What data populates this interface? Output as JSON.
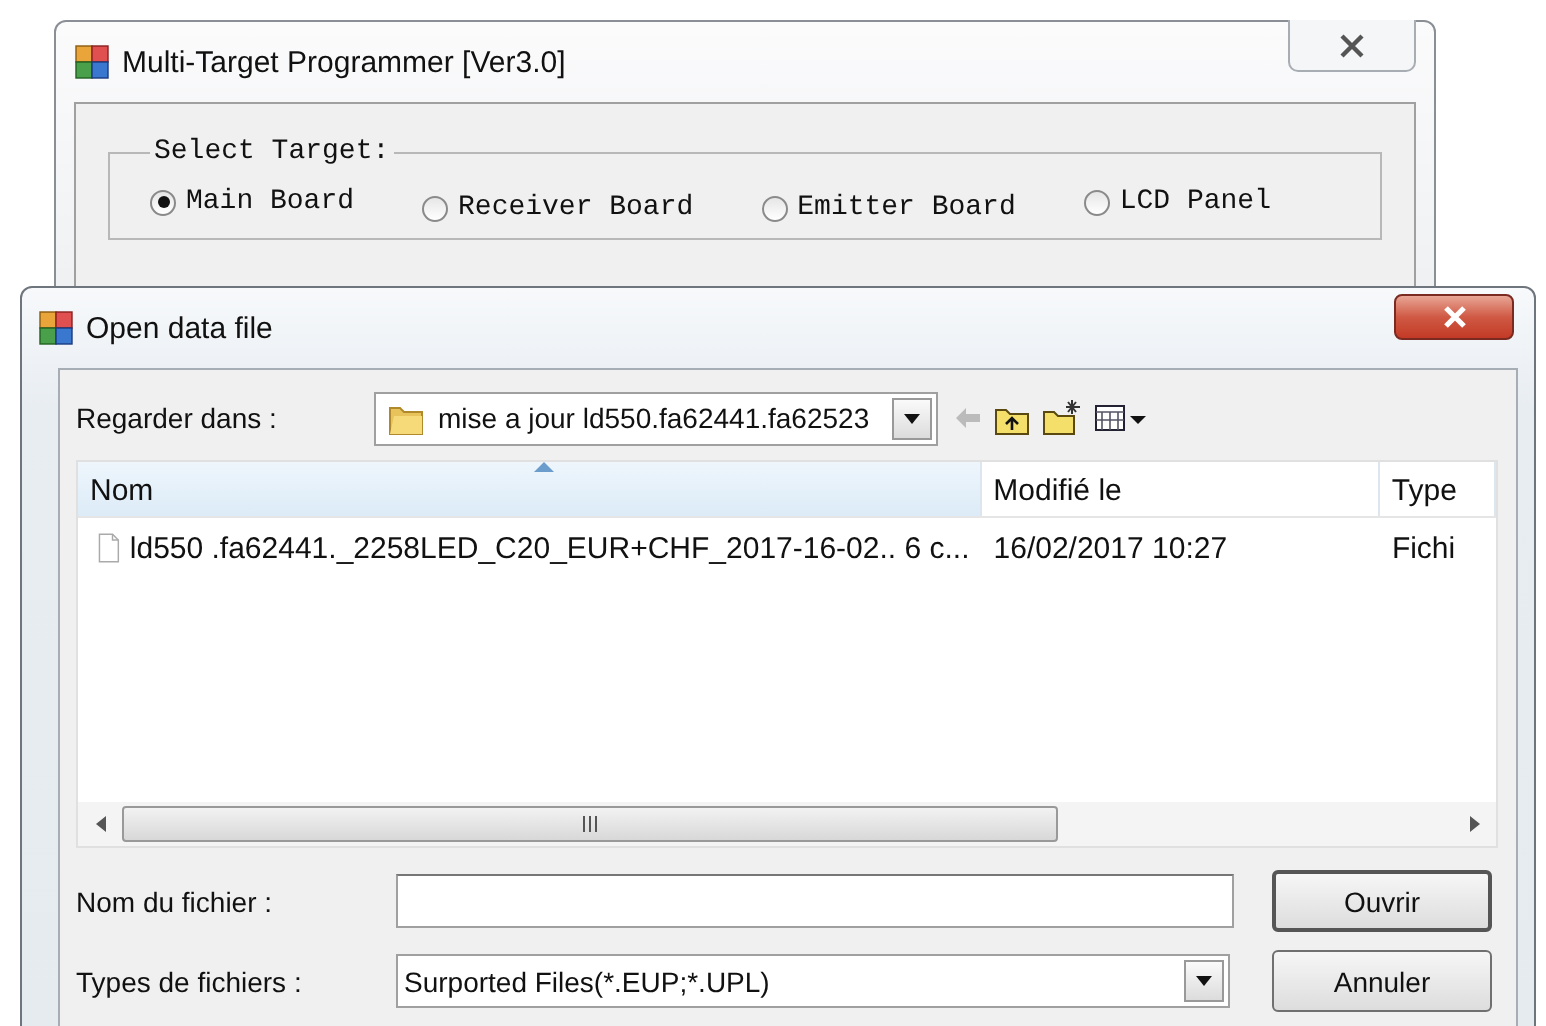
{
  "main_window": {
    "title": "Multi-Target Programmer [Ver3.0]",
    "target_group": {
      "label": "Select Target:",
      "options": [
        {
          "label": "Main Board",
          "selected": true
        },
        {
          "label": "Receiver Board",
          "selected": false
        },
        {
          "label": "Emitter Board",
          "selected": false
        },
        {
          "label": "LCD Panel",
          "selected": false
        }
      ]
    }
  },
  "dialog": {
    "title": "Open data file",
    "look_in": {
      "label": "Regarder dans :",
      "value": "mise a jour ld550.fa62441.fa62523"
    },
    "columns": [
      {
        "label": "Nom",
        "sorted": true
      },
      {
        "label": "Modifié le",
        "sorted": false
      },
      {
        "label": "Type",
        "sorted": false
      }
    ],
    "rows": [
      {
        "name": "ld550 .fa62441._2258LED_C20_EUR+CHF_2017-16-02.. 6 c...",
        "modified": "16/02/2017 10:27",
        "type": "Fichi"
      }
    ],
    "file_name": {
      "label": "Nom du fichier :"
    },
    "file_types": {
      "label": "Types de fichiers :",
      "value": "Surported Files(*.EUP;*.UPL)"
    },
    "buttons": [
      "Ouvrir",
      "Annuler"
    ]
  }
}
